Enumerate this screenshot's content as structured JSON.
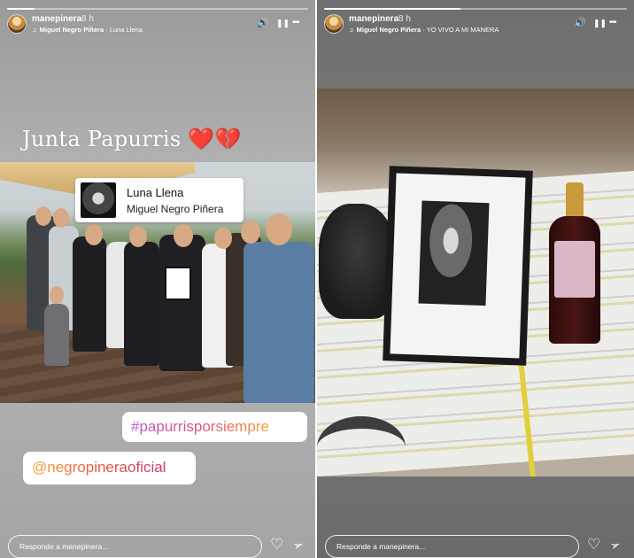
{
  "left_story": {
    "progress": 0.09,
    "username": "manepinera",
    "time": "8 h",
    "music_artist": "Miguel Negro Piñera",
    "music_song": "Luna Llena",
    "music_separator": "·",
    "text_overlay": "Junta Papurris",
    "text_emoji": "❤️💔",
    "music_sticker": {
      "song": "Luna Llena",
      "artist": "Miguel Negro Piñera"
    },
    "hashtag": "#papurrisporsiempre",
    "mention": "@negropineraoficial",
    "reply_placeholder": "Responde a manepinera..."
  },
  "right_story": {
    "progress": 0.45,
    "username": "manepinera",
    "time": "8 h",
    "music_artist": "Miguel Negro Piñera",
    "music_song": "YO VIVO A MI MANERA",
    "music_separator": "·",
    "reply_placeholder": "Responde a manepinera..."
  },
  "icons": {
    "volume": "🔊",
    "pause": "❚❚",
    "more": "•••",
    "music": "♫",
    "like": "♡",
    "send": "➢"
  },
  "colors": {
    "hashtag_gradient": [
      "#b65cc7",
      "#e2507c",
      "#f0a23a"
    ],
    "mention_gradient": [
      "#f7a637",
      "#e8573a",
      "#c9377c"
    ]
  }
}
